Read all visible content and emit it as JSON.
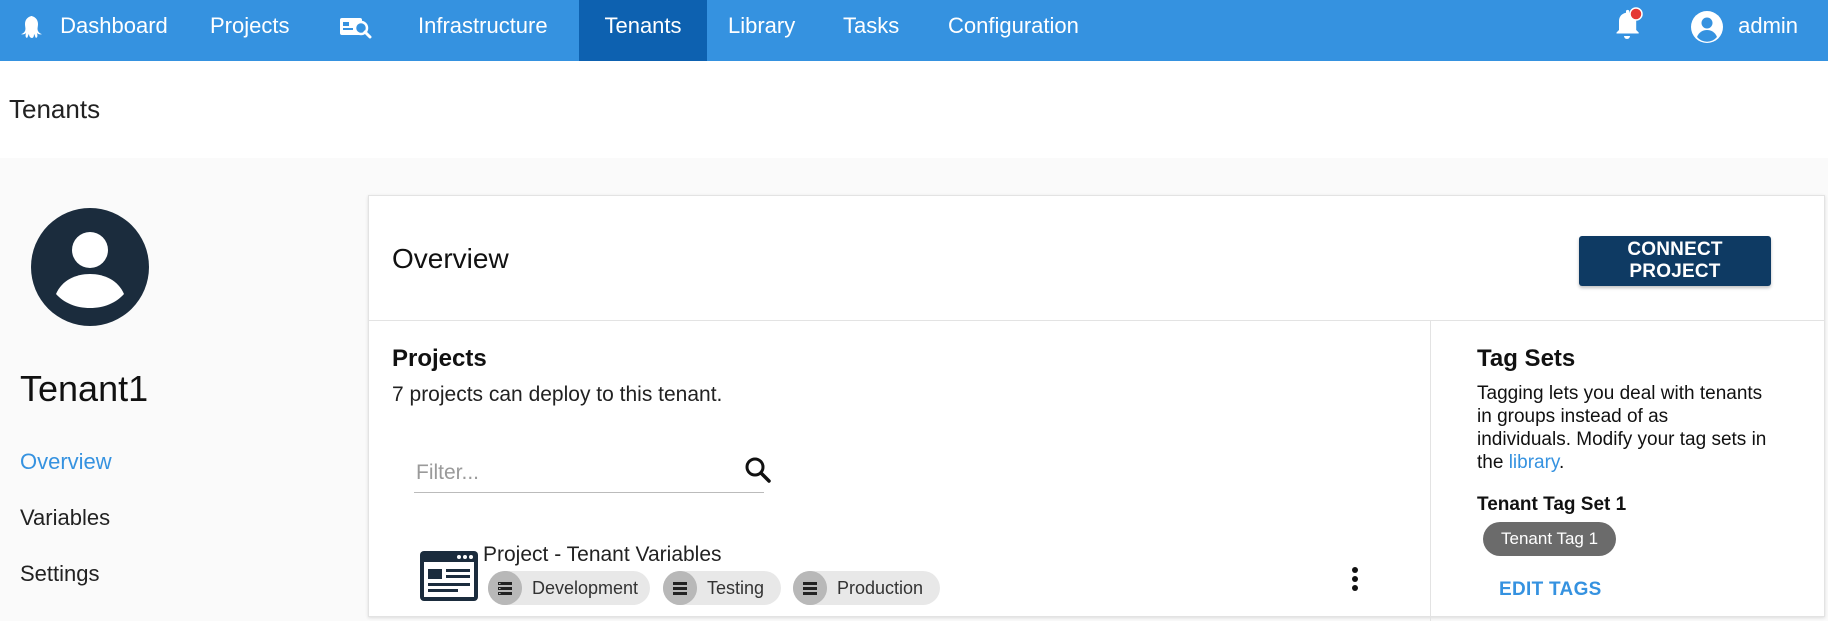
{
  "nav": {
    "items": [
      {
        "label": "Dashboard",
        "icon": "octopus-logo-icon"
      },
      {
        "label": "Projects"
      },
      {
        "label": "",
        "icon": "search-machines-icon"
      },
      {
        "label": "Infrastructure"
      },
      {
        "label": "Tenants",
        "active": true
      },
      {
        "label": "Library"
      },
      {
        "label": "Tasks"
      },
      {
        "label": "Configuration"
      }
    ],
    "user": "admin",
    "notification_icon": "bell-icon",
    "accent": "#3592e0",
    "active_bg": "#0d61b0"
  },
  "page": {
    "title": "Tenants"
  },
  "sidebar": {
    "tenant_name": "Tenant1",
    "links": [
      {
        "label": "Overview",
        "active": true
      },
      {
        "label": "Variables"
      },
      {
        "label": "Settings"
      }
    ]
  },
  "overview": {
    "title": "Overview",
    "connect_label": "CONNECT PROJECT",
    "projects": {
      "title": "Projects",
      "description": "7 projects can deploy to this tenant.",
      "filter_placeholder": "Filter...",
      "items": [
        {
          "name": "Project - Tenant Variables",
          "environments": [
            "Development",
            "Testing",
            "Production"
          ]
        }
      ]
    },
    "tag_sets": {
      "title": "Tag Sets",
      "description_before": "Tagging lets you deal with tenants in groups instead of as individuals. Modify your tag sets in the ",
      "link_text": "library",
      "description_after": ".",
      "sets": [
        {
          "name": "Tenant Tag Set 1",
          "tags": [
            "Tenant Tag 1"
          ]
        }
      ],
      "edit_label": "EDIT TAGS"
    }
  }
}
